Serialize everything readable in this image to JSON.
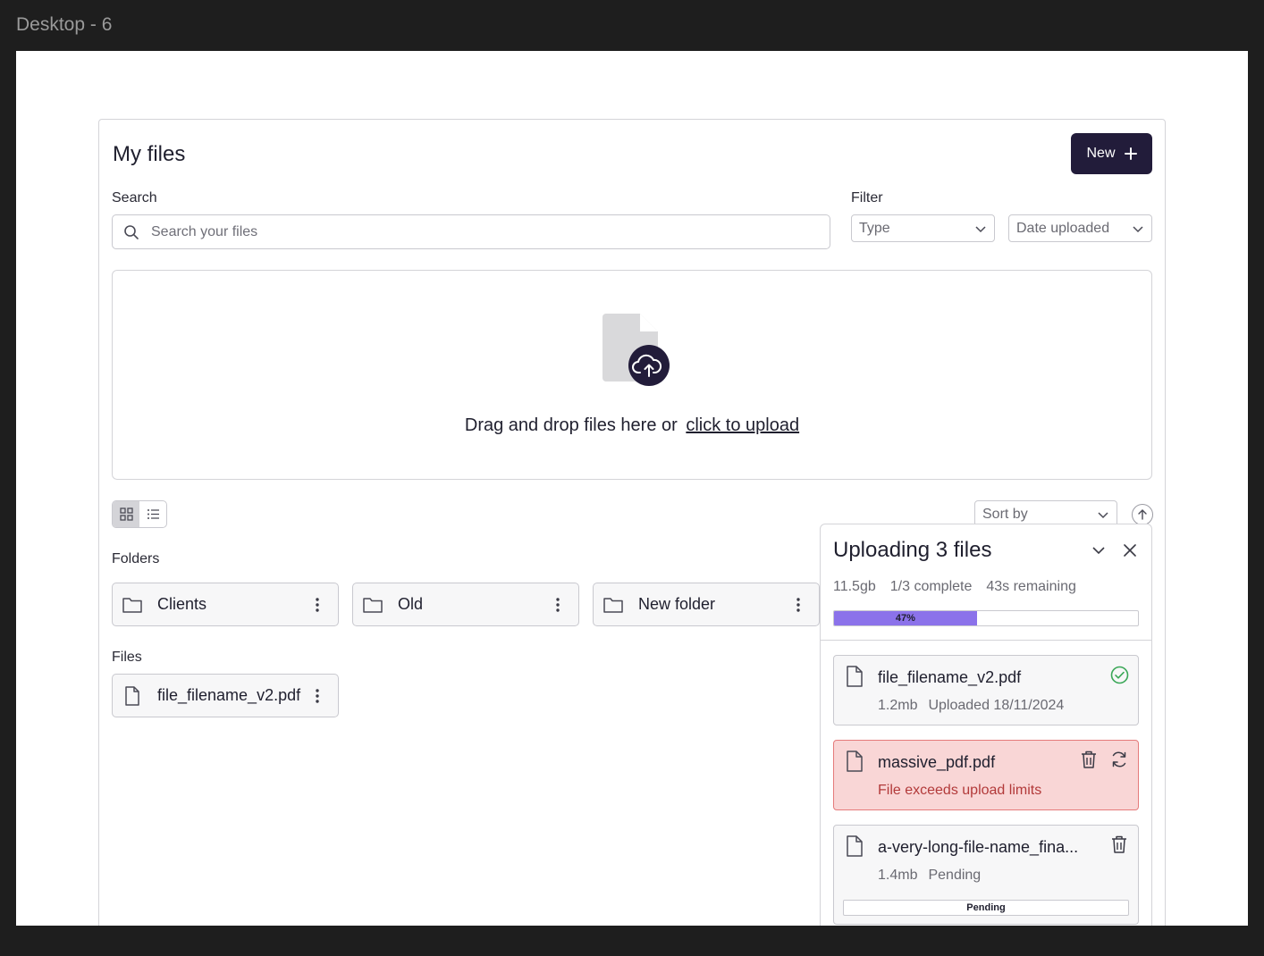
{
  "frame": {
    "title": "Desktop - 6"
  },
  "header": {
    "title": "My files",
    "new_label": "New"
  },
  "search": {
    "label": "Search",
    "placeholder": "Search your files",
    "value": ""
  },
  "filter": {
    "label": "Filter",
    "type_placeholder": "Type",
    "date_placeholder": "Date uploaded"
  },
  "dropzone": {
    "text": "Drag and drop files here or",
    "link": "click to upload"
  },
  "sort": {
    "placeholder": "Sort by"
  },
  "folders": {
    "heading": "Folders",
    "items": [
      {
        "name": "Clients"
      },
      {
        "name": "Old"
      },
      {
        "name": "New folder"
      }
    ]
  },
  "files": {
    "heading": "Files",
    "items": [
      {
        "name": "file_filename_v2.pdf"
      }
    ]
  },
  "upload_panel": {
    "title": "Uploading 3 files",
    "size": "11.5gb",
    "complete": "1/3 complete",
    "remaining": "43s remaining",
    "progress_percent": 47,
    "progress_label": "47%",
    "items": [
      {
        "name": "file_filename_v2.pdf",
        "size": "1.2mb",
        "status": "Uploaded 18/11/2024",
        "state": "done"
      },
      {
        "name": "massive_pdf.pdf",
        "error": "File exceeds upload limits",
        "state": "error"
      },
      {
        "name": "a-very-long-file-name_fina...",
        "size": "1.4mb",
        "status": "Pending",
        "bar_label": "Pending",
        "state": "pending"
      }
    ]
  },
  "colors": {
    "primary": "#221c3a",
    "progress": "#8b72ea",
    "success": "#3aa757",
    "error_bg": "#f9d6d6",
    "error_border": "#e57b7b",
    "error_text": "#b23a3a"
  }
}
